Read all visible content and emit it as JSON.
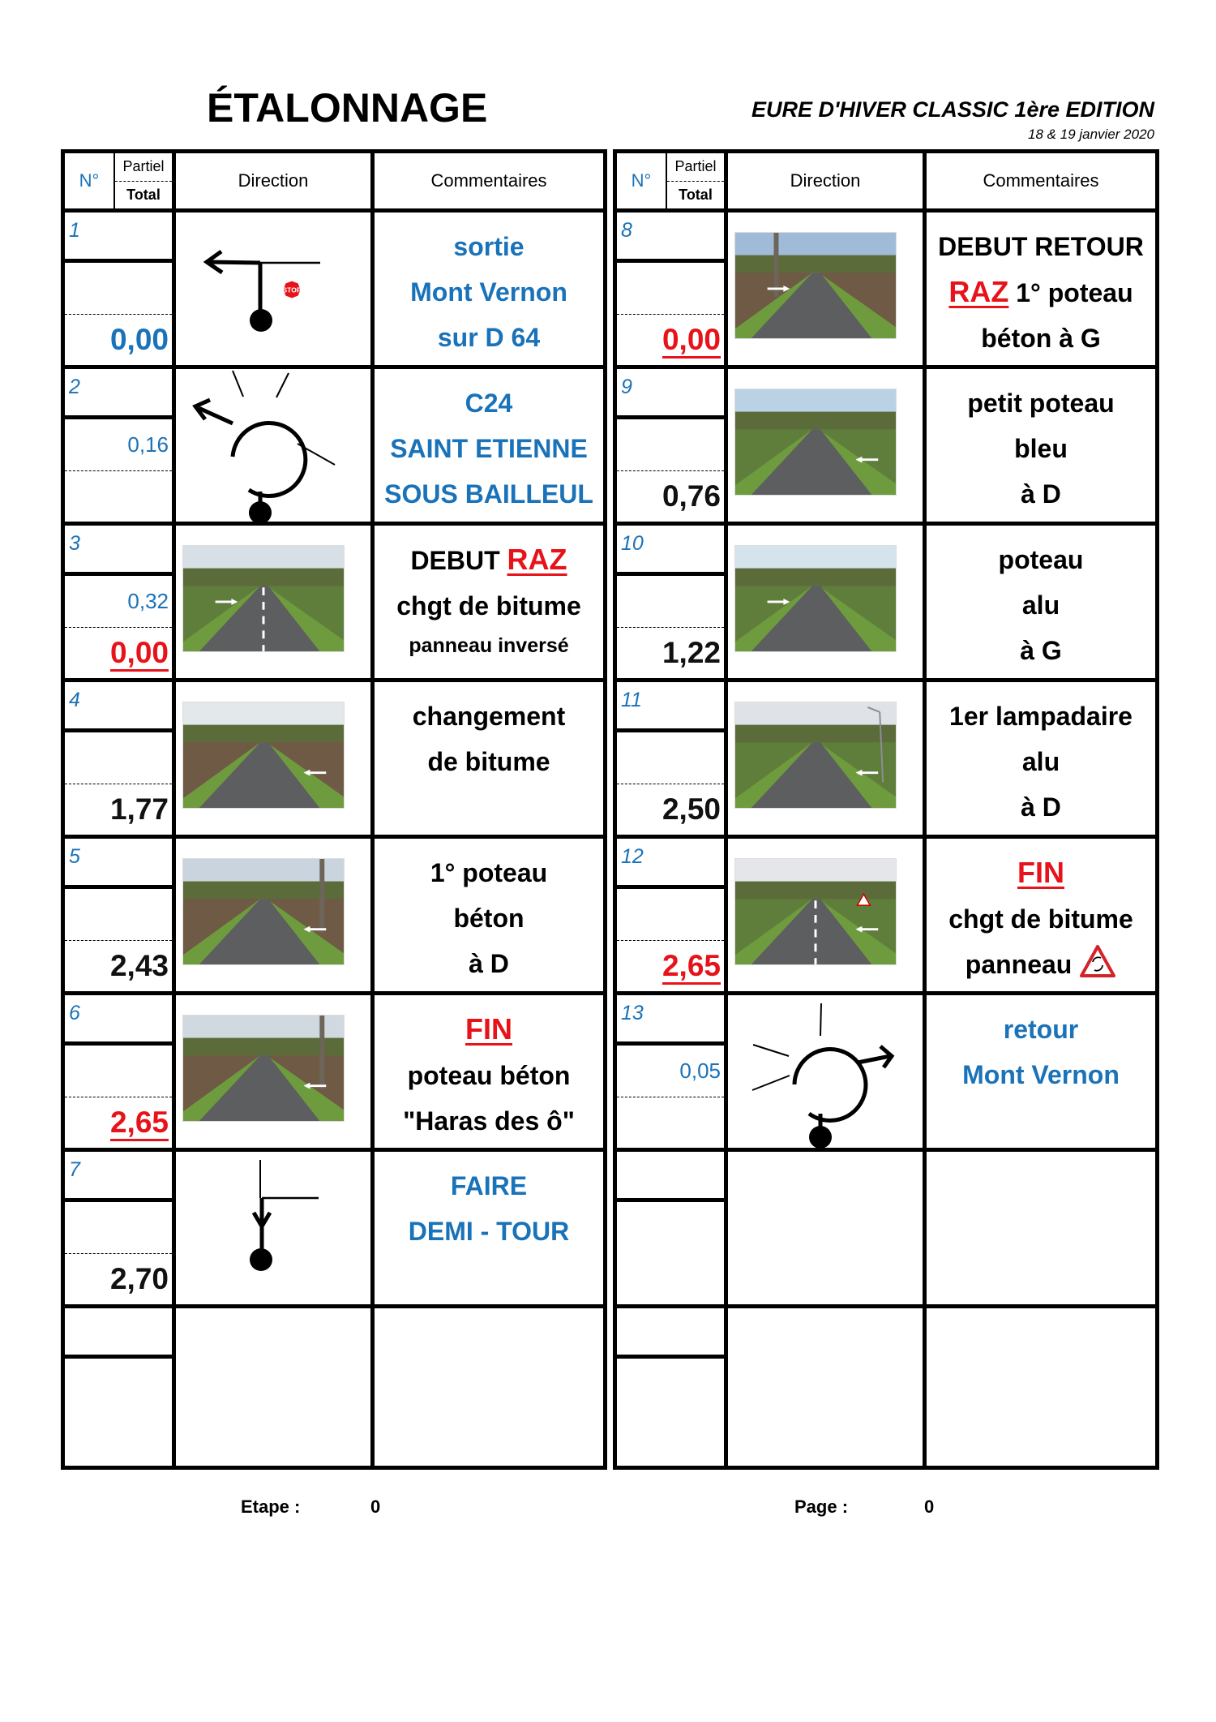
{
  "header": {
    "title": "ÉTALONNAGE",
    "event_name": "EURE D'HIVER CLASSIC 1ère EDITION",
    "event_date": "18 & 19 janvier 2020"
  },
  "columns": {
    "number": "N°",
    "partial": "Partiel",
    "total": "Total",
    "direction": "Direction",
    "comments": "Commentaires"
  },
  "colors": {
    "blue": "#1a72b8",
    "red": "#e8131a",
    "black": "#000000"
  },
  "left_table": [
    {
      "number": "1",
      "partial": "",
      "total": "0,00",
      "total_style": "blue",
      "direction": "tulip-stop-left-turn-icon",
      "comments": [
        {
          "text": "sortie",
          "color": "blue"
        },
        {
          "text": "Mont Vernon",
          "color": "blue"
        },
        {
          "text": "sur  D 64",
          "color": "blue"
        }
      ]
    },
    {
      "number": "2",
      "partial": "0,16",
      "total": "",
      "total_style": "black",
      "direction": "tulip-roundabout-exit-left-icon",
      "comments": [
        {
          "text": "C24",
          "color": "blue"
        },
        {
          "text": "SAINT ETIENNE",
          "color": "blue"
        },
        {
          "text": "SOUS BAILLEUL",
          "color": "blue"
        }
      ]
    },
    {
      "number": "3",
      "partial": "0,32",
      "total": "0,00",
      "total_style": "red-underline",
      "direction": "road-photo-bitumen-change",
      "comments": [
        {
          "text": "DEBUT",
          "color": "black",
          "suffix": "RAZ"
        },
        {
          "text": "chgt de bitume",
          "color": "black"
        },
        {
          "text": "panneau inversé",
          "color": "black",
          "size": "small"
        }
      ]
    },
    {
      "number": "4",
      "partial": "",
      "total": "1,77",
      "total_style": "black",
      "direction": "road-photo-bitumen-change-field",
      "comments": [
        {
          "text": "changement",
          "color": "black"
        },
        {
          "text": "de bitume",
          "color": "black"
        }
      ]
    },
    {
      "number": "5",
      "partial": "",
      "total": "2,43",
      "total_style": "black",
      "direction": "road-photo-concrete-pole-right",
      "comments": [
        {
          "text": "1° poteau",
          "color": "black"
        },
        {
          "text": "béton",
          "color": "black"
        },
        {
          "text": "à D",
          "color": "black"
        }
      ]
    },
    {
      "number": "6",
      "partial": "",
      "total": "2,65",
      "total_style": "red-underline",
      "direction": "road-photo-concrete-pole-haras",
      "comments": [
        {
          "text": "FIN",
          "color": "red-underline"
        },
        {
          "text": "poteau béton",
          "color": "black"
        },
        {
          "text": "\"Haras des ô\"",
          "color": "black"
        }
      ]
    },
    {
      "number": "7",
      "partial": "",
      "total": "2,70",
      "total_style": "black",
      "direction": "tulip-u-turn-icon",
      "comments": [
        {
          "text": "FAIRE",
          "color": "blue"
        },
        {
          "text": "DEMI - TOUR",
          "color": "blue"
        }
      ]
    },
    {
      "number": "",
      "partial": "",
      "total": "",
      "empty": true,
      "comments": []
    }
  ],
  "right_table": [
    {
      "number": "8",
      "partial": "",
      "total": "0,00",
      "total_style": "red-underline",
      "direction": "road-photo-pylons-field",
      "comments": [
        {
          "text": "DEBUT RETOUR",
          "color": "black"
        },
        {
          "text": "1° poteau",
          "color": "black",
          "prefix": "RAZ"
        },
        {
          "text": "béton à G",
          "color": "black"
        }
      ]
    },
    {
      "number": "9",
      "partial": "",
      "total": "0,76",
      "total_style": "black",
      "direction": "road-photo-small-blue-post",
      "comments": [
        {
          "text": "petit poteau",
          "color": "black"
        },
        {
          "text": "bleu",
          "color": "black"
        },
        {
          "text": "à D",
          "color": "black"
        }
      ]
    },
    {
      "number": "10",
      "partial": "",
      "total": "1,22",
      "total_style": "black",
      "direction": "road-photo-alu-pole-left",
      "comments": [
        {
          "text": "poteau",
          "color": "black"
        },
        {
          "text": "alu",
          "color": "black"
        },
        {
          "text": "à G",
          "color": "black"
        }
      ]
    },
    {
      "number": "11",
      "partial": "",
      "total": "2,50",
      "total_style": "black",
      "direction": "road-photo-street-lamp",
      "comments": [
        {
          "text": "1er lampadaire",
          "color": "black"
        },
        {
          "text": "alu",
          "color": "black"
        },
        {
          "text": "à D",
          "color": "black"
        }
      ]
    },
    {
      "number": "12",
      "partial": "",
      "total": "2,65",
      "total_style": "red-underline",
      "direction": "road-photo-roundabout-sign",
      "comments": [
        {
          "text": "FIN",
          "color": "red-underline"
        },
        {
          "text": "chgt de bitume",
          "color": "black"
        },
        {
          "text": "panneau",
          "color": "black",
          "icon": "roundabout-warning-sign-icon"
        }
      ]
    },
    {
      "number": "13",
      "partial": "0,05",
      "total": "",
      "total_style": "black",
      "direction": "tulip-roundabout-exit-right-icon",
      "comments": [
        {
          "text": "retour",
          "color": "blue"
        },
        {
          "text": "Mont Vernon",
          "color": "blue"
        }
      ]
    },
    {
      "number": "",
      "partial": "",
      "total": "",
      "empty": true,
      "comments": []
    },
    {
      "number": "",
      "partial": "",
      "total": "",
      "empty": true,
      "comments": []
    }
  ],
  "footer": {
    "stage_label": "Etape :",
    "stage_value": "0",
    "page_label": "Page :",
    "page_value": "0"
  }
}
